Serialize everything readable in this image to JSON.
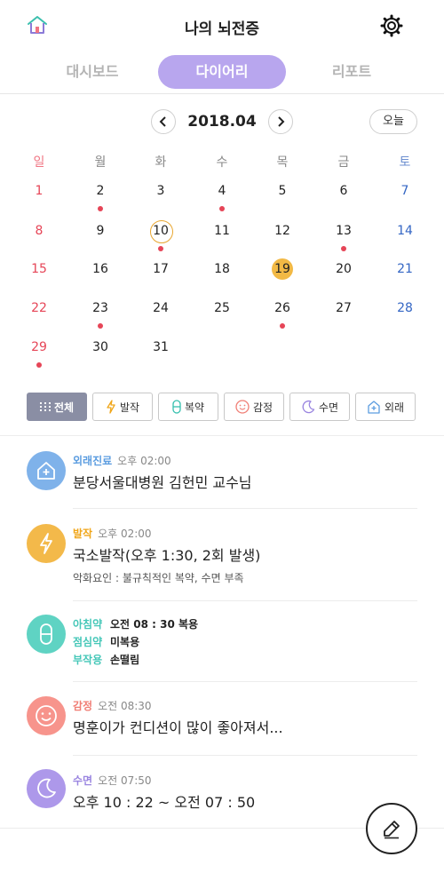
{
  "header": {
    "title": "나의 뇌전증",
    "home_icon": "home-icon",
    "settings_icon": "gear-icon"
  },
  "tabs": [
    {
      "label": "대시보드",
      "active": false
    },
    {
      "label": "다이어리",
      "active": true
    },
    {
      "label": "리포트",
      "active": false
    }
  ],
  "calendar": {
    "month_label": "2018.04",
    "today_label": "오늘",
    "weekdays": [
      "일",
      "월",
      "화",
      "수",
      "목",
      "금",
      "토"
    ],
    "weeks": [
      [
        "1",
        "2",
        "3",
        "4",
        "5",
        "6",
        "7"
      ],
      [
        "8",
        "9",
        "10",
        "11",
        "12",
        "13",
        "14"
      ],
      [
        "15",
        "16",
        "17",
        "18",
        "19",
        "20",
        "21"
      ],
      [
        "22",
        "23",
        "24",
        "25",
        "26",
        "27",
        "28"
      ],
      [
        "29",
        "30",
        "31",
        "",
        "",
        "",
        ""
      ]
    ],
    "days_with_records": [
      2,
      4,
      10,
      13,
      23,
      26,
      29
    ],
    "outlined_day": 10,
    "selected_day": 19
  },
  "filters": [
    {
      "label": "전체",
      "icon": "grid-icon",
      "active": true
    },
    {
      "label": "발작",
      "icon": "lightning-icon",
      "active": false
    },
    {
      "label": "복약",
      "icon": "pill-icon",
      "active": false
    },
    {
      "label": "감정",
      "icon": "smile-icon",
      "active": false
    },
    {
      "label": "수면",
      "icon": "moon-icon",
      "active": false
    },
    {
      "label": "외래",
      "icon": "hospital-icon",
      "active": false
    }
  ],
  "entries": {
    "outpatient": {
      "category": "외래진료",
      "time": "오후 02:00",
      "main": "분당서울대병원 김헌민 교수님",
      "color": "#7fb2ea"
    },
    "seizure": {
      "category": "발작",
      "time": "오후 02:00",
      "main": "국소발작(오후 1:30, 2회 발생)",
      "sub": "악화요인 : 불규칙적인 복약, 수면 부족",
      "color": "#f3b94a"
    },
    "medication": {
      "rows": [
        {
          "label": "아침약",
          "value": "오전 08 : 30 복용"
        },
        {
          "label": "점심약",
          "value": "미복용"
        },
        {
          "label": "부작용",
          "value": "손떨림"
        }
      ],
      "color": "#5fd3c3"
    },
    "emotion": {
      "category": "감정",
      "time": "오전 08:30",
      "main": "명훈이가 컨디션이 많이 좋아져서...",
      "color": "#f7948c"
    },
    "sleep": {
      "category": "수면",
      "time": "오전 07:50",
      "main": "오후 10 : 22 ~ 오전 07 : 50",
      "color": "#ad98ea"
    }
  },
  "fab_icon": "pencil-icon"
}
